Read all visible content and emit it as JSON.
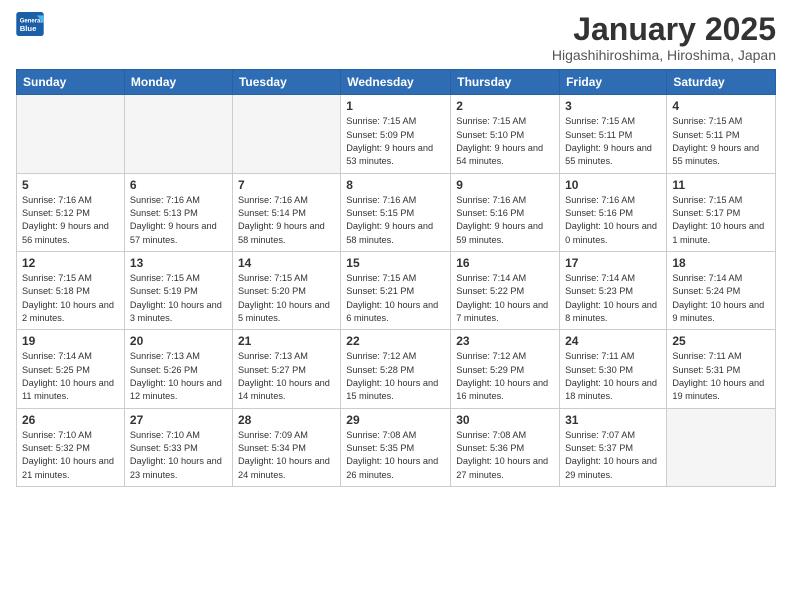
{
  "header": {
    "logo_line1": "General",
    "logo_line2": "Blue",
    "title": "January 2025",
    "location": "Higashihiroshima, Hiroshima, Japan"
  },
  "days_of_week": [
    "Sunday",
    "Monday",
    "Tuesday",
    "Wednesday",
    "Thursday",
    "Friday",
    "Saturday"
  ],
  "weeks": [
    [
      {
        "day": "",
        "empty": true
      },
      {
        "day": "",
        "empty": true
      },
      {
        "day": "",
        "empty": true
      },
      {
        "day": "1",
        "sunrise": "7:15 AM",
        "sunset": "5:09 PM",
        "daylight": "9 hours and 53 minutes."
      },
      {
        "day": "2",
        "sunrise": "7:15 AM",
        "sunset": "5:10 PM",
        "daylight": "9 hours and 54 minutes."
      },
      {
        "day": "3",
        "sunrise": "7:15 AM",
        "sunset": "5:11 PM",
        "daylight": "9 hours and 55 minutes."
      },
      {
        "day": "4",
        "sunrise": "7:15 AM",
        "sunset": "5:11 PM",
        "daylight": "9 hours and 55 minutes."
      }
    ],
    [
      {
        "day": "5",
        "sunrise": "7:16 AM",
        "sunset": "5:12 PM",
        "daylight": "9 hours and 56 minutes."
      },
      {
        "day": "6",
        "sunrise": "7:16 AM",
        "sunset": "5:13 PM",
        "daylight": "9 hours and 57 minutes."
      },
      {
        "day": "7",
        "sunrise": "7:16 AM",
        "sunset": "5:14 PM",
        "daylight": "9 hours and 58 minutes."
      },
      {
        "day": "8",
        "sunrise": "7:16 AM",
        "sunset": "5:15 PM",
        "daylight": "9 hours and 58 minutes."
      },
      {
        "day": "9",
        "sunrise": "7:16 AM",
        "sunset": "5:16 PM",
        "daylight": "9 hours and 59 minutes."
      },
      {
        "day": "10",
        "sunrise": "7:16 AM",
        "sunset": "5:16 PM",
        "daylight": "10 hours and 0 minutes."
      },
      {
        "day": "11",
        "sunrise": "7:15 AM",
        "sunset": "5:17 PM",
        "daylight": "10 hours and 1 minute."
      }
    ],
    [
      {
        "day": "12",
        "sunrise": "7:15 AM",
        "sunset": "5:18 PM",
        "daylight": "10 hours and 2 minutes."
      },
      {
        "day": "13",
        "sunrise": "7:15 AM",
        "sunset": "5:19 PM",
        "daylight": "10 hours and 3 minutes."
      },
      {
        "day": "14",
        "sunrise": "7:15 AM",
        "sunset": "5:20 PM",
        "daylight": "10 hours and 5 minutes."
      },
      {
        "day": "15",
        "sunrise": "7:15 AM",
        "sunset": "5:21 PM",
        "daylight": "10 hours and 6 minutes."
      },
      {
        "day": "16",
        "sunrise": "7:14 AM",
        "sunset": "5:22 PM",
        "daylight": "10 hours and 7 minutes."
      },
      {
        "day": "17",
        "sunrise": "7:14 AM",
        "sunset": "5:23 PM",
        "daylight": "10 hours and 8 minutes."
      },
      {
        "day": "18",
        "sunrise": "7:14 AM",
        "sunset": "5:24 PM",
        "daylight": "10 hours and 9 minutes."
      }
    ],
    [
      {
        "day": "19",
        "sunrise": "7:14 AM",
        "sunset": "5:25 PM",
        "daylight": "10 hours and 11 minutes."
      },
      {
        "day": "20",
        "sunrise": "7:13 AM",
        "sunset": "5:26 PM",
        "daylight": "10 hours and 12 minutes."
      },
      {
        "day": "21",
        "sunrise": "7:13 AM",
        "sunset": "5:27 PM",
        "daylight": "10 hours and 14 minutes."
      },
      {
        "day": "22",
        "sunrise": "7:12 AM",
        "sunset": "5:28 PM",
        "daylight": "10 hours and 15 minutes."
      },
      {
        "day": "23",
        "sunrise": "7:12 AM",
        "sunset": "5:29 PM",
        "daylight": "10 hours and 16 minutes."
      },
      {
        "day": "24",
        "sunrise": "7:11 AM",
        "sunset": "5:30 PM",
        "daylight": "10 hours and 18 minutes."
      },
      {
        "day": "25",
        "sunrise": "7:11 AM",
        "sunset": "5:31 PM",
        "daylight": "10 hours and 19 minutes."
      }
    ],
    [
      {
        "day": "26",
        "sunrise": "7:10 AM",
        "sunset": "5:32 PM",
        "daylight": "10 hours and 21 minutes."
      },
      {
        "day": "27",
        "sunrise": "7:10 AM",
        "sunset": "5:33 PM",
        "daylight": "10 hours and 23 minutes."
      },
      {
        "day": "28",
        "sunrise": "7:09 AM",
        "sunset": "5:34 PM",
        "daylight": "10 hours and 24 minutes."
      },
      {
        "day": "29",
        "sunrise": "7:08 AM",
        "sunset": "5:35 PM",
        "daylight": "10 hours and 26 minutes."
      },
      {
        "day": "30",
        "sunrise": "7:08 AM",
        "sunset": "5:36 PM",
        "daylight": "10 hours and 27 minutes."
      },
      {
        "day": "31",
        "sunrise": "7:07 AM",
        "sunset": "5:37 PM",
        "daylight": "10 hours and 29 minutes."
      },
      {
        "day": "",
        "empty": true
      }
    ]
  ]
}
